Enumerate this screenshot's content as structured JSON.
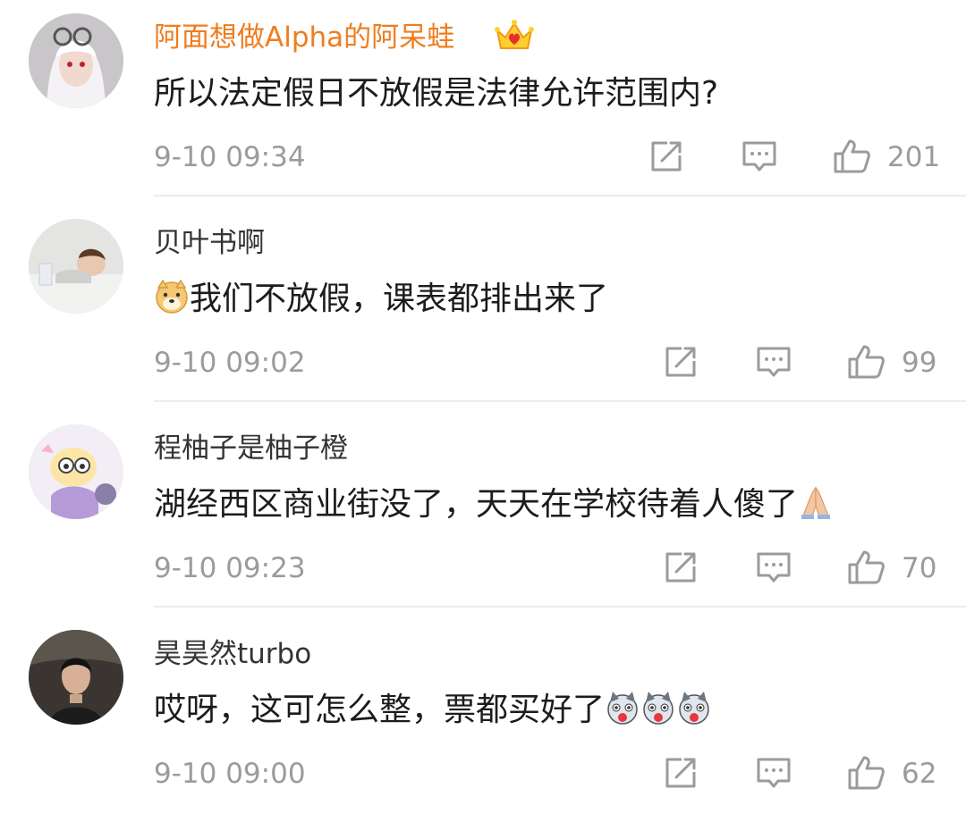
{
  "colors": {
    "vip_name": "#ef7d1f",
    "name": "#333333",
    "text": "#1c1c1c",
    "meta": "#9b9b9b",
    "divider": "#ececec"
  },
  "comments": [
    {
      "username": "阿面想做Alpha的阿呆蛙",
      "vip": true,
      "badge_icon": "vip-crown-icon",
      "content": "所以法定假日不放假是法律允许范围内?",
      "timestamp": "9-10 09:34",
      "likes": "201"
    },
    {
      "username": "贝叶书啊",
      "vip": false,
      "lead_emoji": "doge-emoji-icon",
      "content": "我们不放假，课表都排出来了",
      "timestamp": "9-10 09:02",
      "likes": "99"
    },
    {
      "username": "程柚子是柚子橙",
      "vip": false,
      "content": "湖经西区商业街没了，天天在学校待着人傻了",
      "trail_emoji": "pray-emoji-icon",
      "timestamp": "9-10 09:23",
      "likes": "70"
    },
    {
      "username": "昊昊然turbo",
      "vip": false,
      "content": "哎呀，这可怎么整，票都买好了",
      "trail_emoji": "husky-emoji-icon",
      "timestamp": "9-10 09:00",
      "likes": "62"
    }
  ],
  "action_icons": [
    "share-icon",
    "reply-icon",
    "like-icon"
  ]
}
